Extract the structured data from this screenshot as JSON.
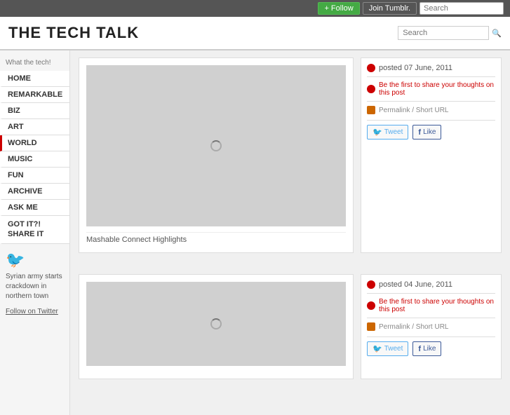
{
  "topbar": {
    "follow_label": "+ Follow",
    "join_label": "Join Tumblr.",
    "search_placeholder": "Search"
  },
  "header": {
    "title": "THE TECH TALK",
    "search_placeholder": "Search"
  },
  "sidebar": {
    "tagline": "What the tech!",
    "nav_items": [
      {
        "label": "HOME",
        "id": "home"
      },
      {
        "label": "REMARKABLE",
        "id": "remarkable"
      },
      {
        "label": "BIZ",
        "id": "biz"
      },
      {
        "label": "ART",
        "id": "art"
      },
      {
        "label": "WORLD",
        "id": "world",
        "active": true
      },
      {
        "label": "MUSIC",
        "id": "music"
      },
      {
        "label": "FUN",
        "id": "fun"
      },
      {
        "label": "ARCHIVE",
        "id": "archive"
      },
      {
        "label": "ASK ME",
        "id": "ask-me"
      },
      {
        "label": "GOT IT?! SHARE IT",
        "id": "share"
      }
    ],
    "twitter_text": "Syrian army starts crackdown in northern town",
    "follow_twitter": "Follow on Twitter"
  },
  "posts": [
    {
      "id": "post-1",
      "caption": "Mashable Connect Highlights",
      "meta": {
        "date": "posted 07 June, 2011",
        "comments": "Be the first to share your thoughts on this post",
        "permalink": "Permalink / Short URL"
      }
    },
    {
      "id": "post-2",
      "caption": "",
      "meta": {
        "date": "posted 04 June, 2011",
        "comments": "Be the first to share your thoughts on this post",
        "permalink": "Permalink / Short URL"
      }
    }
  ],
  "actions": {
    "tweet": "Tweet",
    "like": "Like"
  }
}
